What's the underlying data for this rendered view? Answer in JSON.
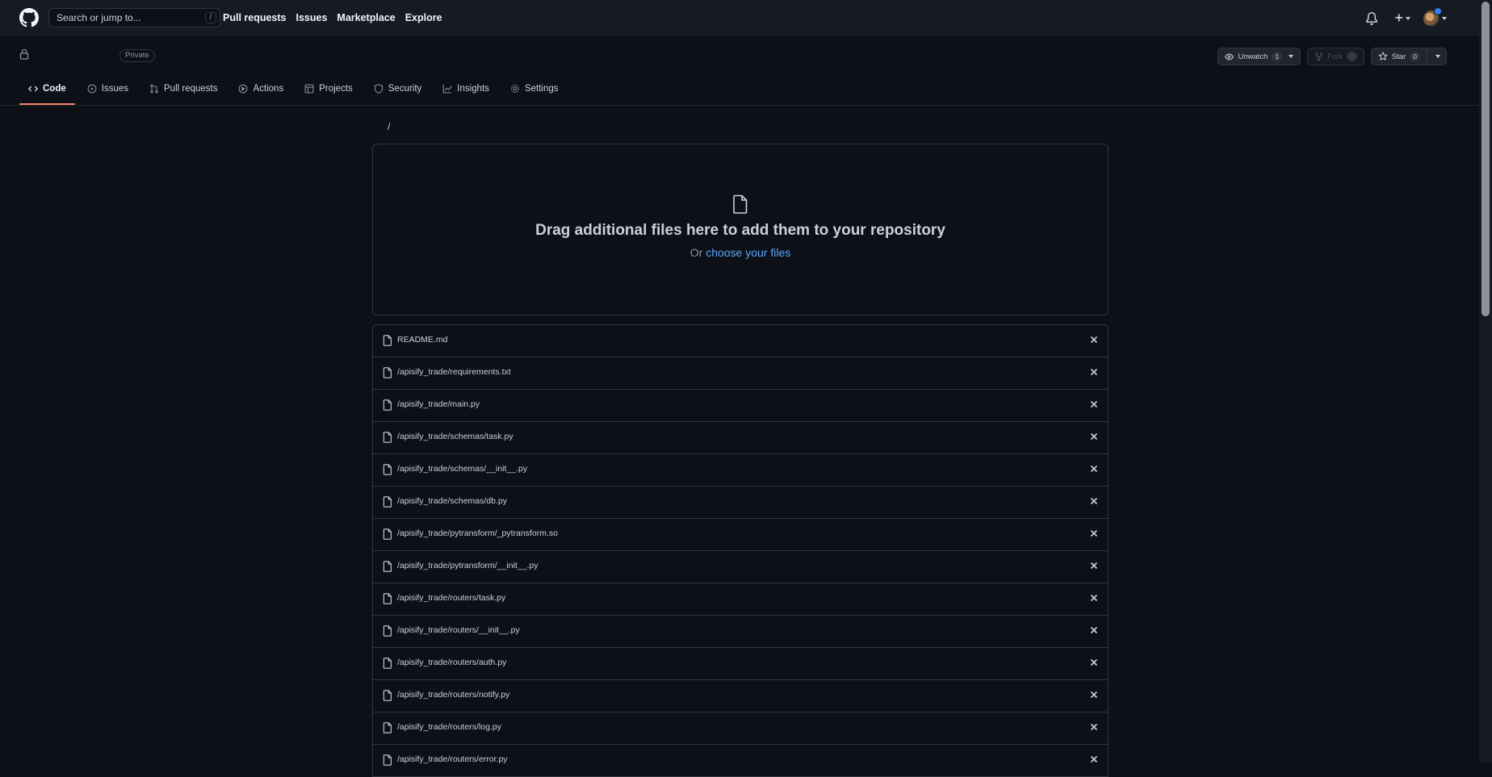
{
  "header": {
    "search_placeholder": "Search or jump to...",
    "search_shortcut": "/",
    "nav": [
      "Pull requests",
      "Issues",
      "Marketplace",
      "Explore"
    ],
    "plus_label": "+"
  },
  "repo": {
    "visibility": "Private",
    "watch": {
      "label": "Unwatch",
      "count": "1"
    },
    "fork": {
      "label": "Fork",
      "count": "0"
    },
    "star": {
      "label": "Star",
      "count": "0"
    },
    "tabs": [
      {
        "label": "Code",
        "icon": "code-icon",
        "active": true
      },
      {
        "label": "Issues",
        "icon": "issue-icon"
      },
      {
        "label": "Pull requests",
        "icon": "pull-request-icon"
      },
      {
        "label": "Actions",
        "icon": "play-icon"
      },
      {
        "label": "Projects",
        "icon": "table-icon"
      },
      {
        "label": "Security",
        "icon": "shield-icon"
      },
      {
        "label": "Insights",
        "icon": "graph-icon"
      },
      {
        "label": "Settings",
        "icon": "gear-icon"
      }
    ]
  },
  "breadcrumb": "/",
  "dropzone": {
    "title": "Drag additional files here to add them to your repository",
    "prefix": "Or",
    "link": "choose your files"
  },
  "files": [
    "README.md",
    "/apisify_trade/requirements.txt",
    "/apisify_trade/main.py",
    "/apisify_trade/schemas/task.py",
    "/apisify_trade/schemas/__init__.py",
    "/apisify_trade/schemas/db.py",
    "/apisify_trade/pytransform/_pytransform.so",
    "/apisify_trade/pytransform/__init__.py",
    "/apisify_trade/routers/task.py",
    "/apisify_trade/routers/__init__.py",
    "/apisify_trade/routers/auth.py",
    "/apisify_trade/routers/notify.py",
    "/apisify_trade/routers/log.py",
    "/apisify_trade/routers/error.py"
  ],
  "colors": {
    "accent": "#f78166",
    "link": "#58a6ff",
    "bg": "#0d1117"
  }
}
